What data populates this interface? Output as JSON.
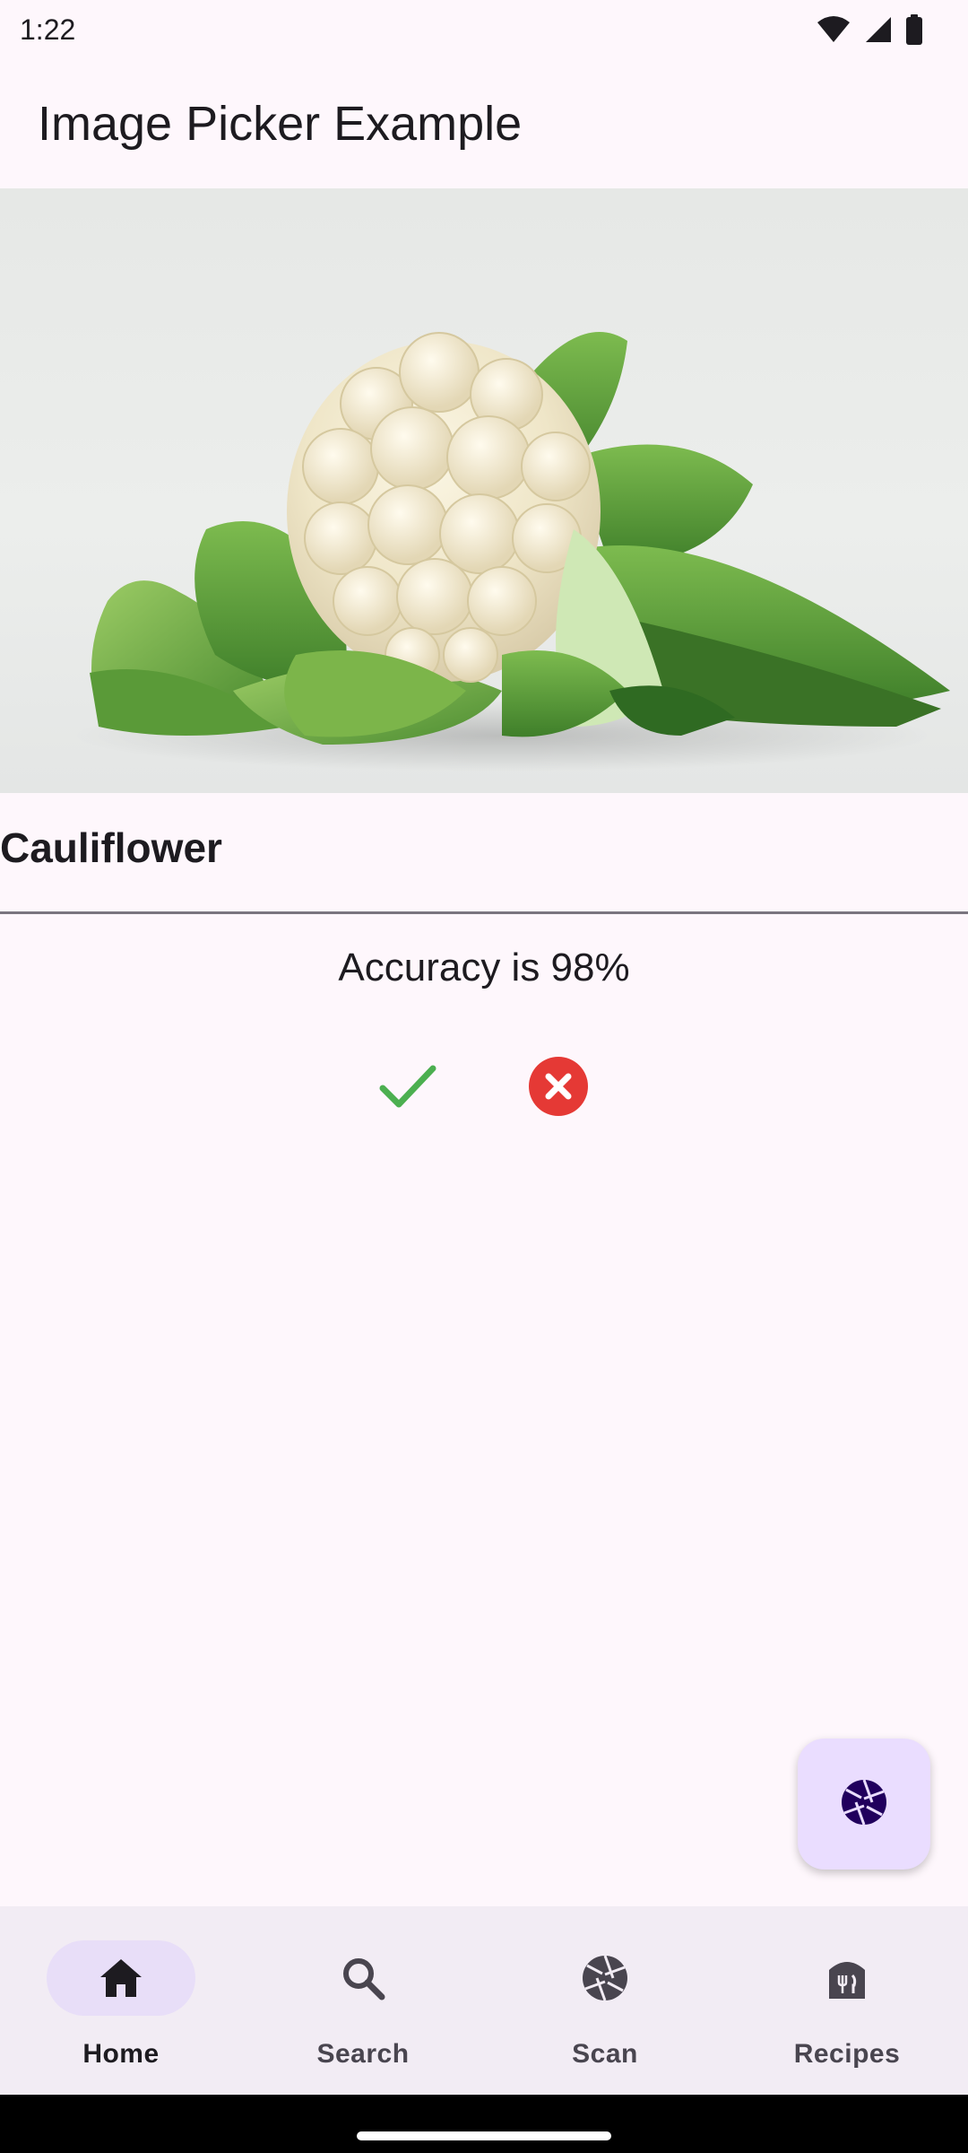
{
  "status_bar": {
    "time": "1:22",
    "icons": [
      "wifi-icon",
      "signal-icon",
      "battery-icon"
    ]
  },
  "app_bar": {
    "title": "Image Picker Example"
  },
  "hero_image": {
    "subject": "cauliflower-photo"
  },
  "result": {
    "label": "Cauliflower",
    "accuracy_text": "Accuracy is 98%",
    "accuracy_percent": 98
  },
  "feedback": {
    "confirm_icon": "check-icon",
    "reject_icon": "cancel-circle-icon",
    "confirm_color": "#4CAF50",
    "reject_color": "#E53935"
  },
  "fab": {
    "icon": "camera-aperture-icon",
    "background": "#EADDFF"
  },
  "bottom_nav": {
    "items": [
      {
        "label": "Home",
        "icon": "home-icon",
        "active": true
      },
      {
        "label": "Search",
        "icon": "search-icon",
        "active": false
      },
      {
        "label": "Scan",
        "icon": "camera-aperture-icon",
        "active": false
      },
      {
        "label": "Recipes",
        "icon": "recipes-icon",
        "active": false
      }
    ]
  },
  "colors": {
    "background": "#FEF7FC",
    "nav_background": "#F2ECF4",
    "active_pill": "#E8DEF8",
    "text": "#1D1B20"
  }
}
